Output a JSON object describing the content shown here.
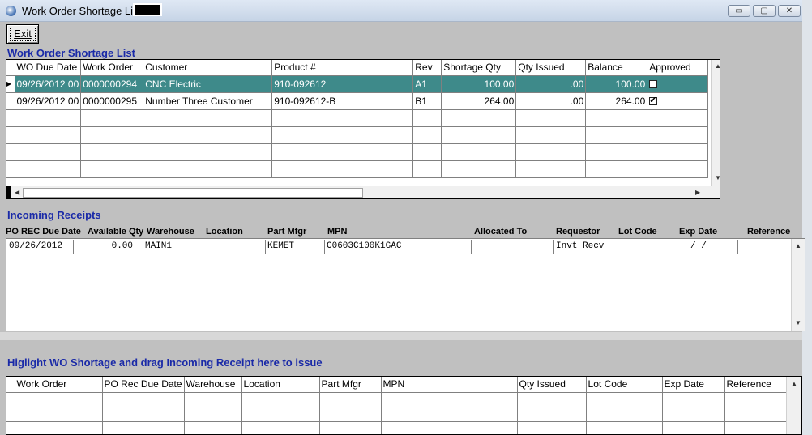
{
  "window": {
    "title": "Work Order Shortage List",
    "minimize_glyph": "▭",
    "maximize_glyph": "▢",
    "close_glyph": "✕"
  },
  "toolbar": {
    "exit_label": "Exit"
  },
  "shortage": {
    "title": "Work Order Shortage List",
    "columns": [
      "WO Due Date",
      "Work Order",
      "Customer",
      "Product #",
      "Rev",
      "Shortage Qty",
      "Qty Issued",
      "Balance",
      "Approved"
    ],
    "rows": [
      {
        "due_date": "09/26/2012 00",
        "work_order": "0000000294",
        "customer": "CNC Electric",
        "product": "910-092612",
        "rev": "A1",
        "shortage_qty": "100.00",
        "qty_issued": ".00",
        "balance": "100.00",
        "approved": false
      },
      {
        "due_date": "09/26/2012 00",
        "work_order": "0000000295",
        "customer": "Number Three Customer",
        "product": "910-092612-B",
        "rev": "B1",
        "shortage_qty": "264.00",
        "qty_issued": ".00",
        "balance": "264.00",
        "approved": true
      }
    ]
  },
  "incoming": {
    "title": "Incoming Receipts",
    "columns": [
      "PO REC Due Date",
      "Available Qty",
      "Warehouse",
      "Location",
      "Part Mfgr",
      "MPN",
      "Allocated To",
      "Requestor",
      "Lot Code",
      "Exp Date",
      "Reference"
    ],
    "rows": [
      {
        "due_date": "09/26/2012",
        "available_qty": "0.00",
        "warehouse": "MAIN1",
        "location": "",
        "part_mfgr": "KEMET",
        "mpn": "C0603C100K1GAC",
        "allocated_to": "",
        "requestor": "Invt Recv",
        "lot_code": "",
        "exp_date": "/  /",
        "reference": ""
      }
    ]
  },
  "issue": {
    "title": "Higlight WO Shortage and drag Incoming Receipt here to issue",
    "columns": [
      "Work Order",
      "PO Rec Due Date",
      "Warehouse",
      "Location",
      "Part Mfgr",
      "MPN",
      "Qty Issued",
      "Lot Code",
      "Exp Date",
      "Reference"
    ]
  },
  "icons": {
    "scroll_up": "▲",
    "scroll_down": "▼",
    "scroll_left": "◀",
    "scroll_right": "▶",
    "row_pointer": "▶"
  }
}
